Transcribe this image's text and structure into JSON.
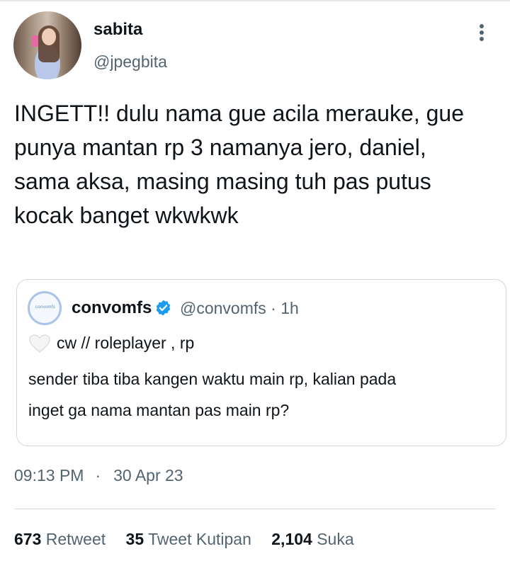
{
  "author": {
    "name": "sabita",
    "handle": "@jpegbita"
  },
  "tweet": {
    "text": "INGETT!! dulu nama gue acila merauke, gue\npunya mantan rp 3 namanya jero, daniel,\nsama aksa, masing masing tuh pas putus\nkocak banget wkwkwk"
  },
  "quoted": {
    "avatar_text": "convomfs",
    "name": "convomfs",
    "handle_time": "@convomfs · 1h",
    "line1": "cw // roleplayer , rp",
    "body": "sender tiba tiba kangen waktu main rp, kalian pada\ninget ga nama mantan pas main rp?",
    "verified_color": "#1d9bf0"
  },
  "meta": {
    "time": "09:13 PM",
    "separator": "·",
    "date": "30 Apr 23"
  },
  "stats": {
    "retweets_count": "673",
    "retweets_label": "Retweet",
    "quotes_count": "35",
    "quotes_label": "Tweet Kutipan",
    "likes_count": "2,104",
    "likes_label": "Suka"
  },
  "icons": {
    "more": "more-vertical-icon",
    "verified": "verified-badge-icon",
    "heart": "white-heart-icon"
  }
}
